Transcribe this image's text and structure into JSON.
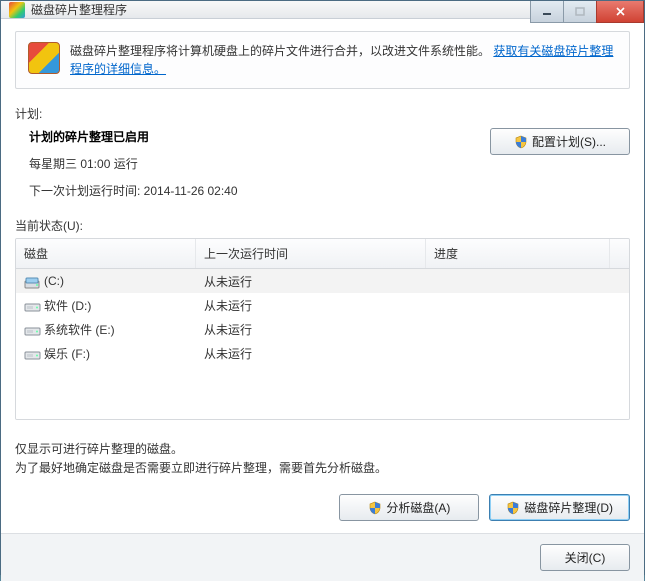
{
  "window": {
    "title": "磁盘碎片整理程序"
  },
  "info": {
    "text_before_link": "磁盘碎片整理程序将计算机硬盘上的碎片文件进行合并，以改进文件系统性能。",
    "link": "获取有关磁盘碎片整理程序的详细信息。"
  },
  "labels": {
    "schedule": "计划:",
    "current_status": "当前状态(U):",
    "configure_button": "配置计划(S)...",
    "analyze_button": "分析磁盘(A)",
    "defrag_button": "磁盘碎片整理(D)",
    "close_button": "关闭(C)"
  },
  "schedule": {
    "enabled_line": "计划的碎片整理已启用",
    "run_line": "每星期三  01:00 运行",
    "next_line": "下一次计划运行时间: 2014-11-26 02:40"
  },
  "table": {
    "headers": {
      "disk": "磁盘",
      "last": "上一次运行时间",
      "progress": "进度"
    },
    "rows": [
      {
        "name": "(C:)",
        "last": "从未运行",
        "type": "c"
      },
      {
        "name": "软件 (D:)",
        "last": "从未运行",
        "type": "hdd"
      },
      {
        "name": "系统软件 (E:)",
        "last": "从未运行",
        "type": "hdd"
      },
      {
        "name": "娱乐 (F:)",
        "last": "从未运行",
        "type": "hdd"
      }
    ]
  },
  "notes": {
    "line1": "仅显示可进行碎片整理的磁盘。",
    "line2": "为了最好地确定磁盘是否需要立即进行碎片整理，需要首先分析磁盘。"
  }
}
